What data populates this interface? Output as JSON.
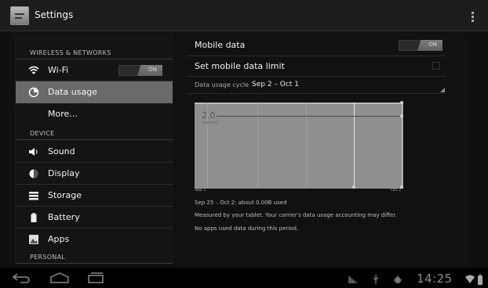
{
  "app_bar": {
    "title": "Settings",
    "icon": "settings-app-icon",
    "overflow_icon": "overflow-menu-icon"
  },
  "sidebar": {
    "categories": [
      "WIRELESS & NETWORKS",
      "DEVICE",
      "PERSONAL"
    ],
    "items": [
      {
        "label": "Wi-Fi",
        "icon": "wifi-icon",
        "toggle": "ON"
      },
      {
        "label": "Data usage",
        "icon": "data-usage-icon",
        "selected": true
      },
      {
        "label": "More…",
        "icon": ""
      },
      {
        "label": "Sound",
        "icon": "sound-icon"
      },
      {
        "label": "Display",
        "icon": "display-icon"
      },
      {
        "label": "Storage",
        "icon": "storage-icon"
      },
      {
        "label": "Battery",
        "icon": "battery-icon"
      },
      {
        "label": "Apps",
        "icon": "apps-icon"
      }
    ]
  },
  "main": {
    "mobile_data": {
      "label": "Mobile data",
      "toggle": "ON"
    },
    "data_limit": {
      "label": "Set mobile data limit",
      "checked": false
    },
    "cycle": {
      "label": "Data usage cycle",
      "value": "Sep 2 – Oct 1"
    },
    "chart": {
      "limit_value": "2.0",
      "limit_caption": "warning",
      "start_label": "Sep 2",
      "end_label": "Oct 2"
    },
    "summary": "Sep 25 – Oct 2: about 0.00B used",
    "disclaimer": "Measured by your tablet. Your carrier's data usage accounting may differ.",
    "no_apps": "No apps used data during this period."
  },
  "system_bar": {
    "back_icon": "back-icon",
    "home_icon": "home-icon",
    "recents_icon": "recent-apps-icon",
    "clock": "14:25",
    "status_icons": [
      "signal-icon",
      "usb-icon",
      "debug-icon",
      "wifi-status-icon",
      "battery-status-icon"
    ]
  },
  "colors": {
    "selected_row": "#6a6a6a",
    "chart_fill": "#8f8f8f",
    "background": "#101010"
  }
}
